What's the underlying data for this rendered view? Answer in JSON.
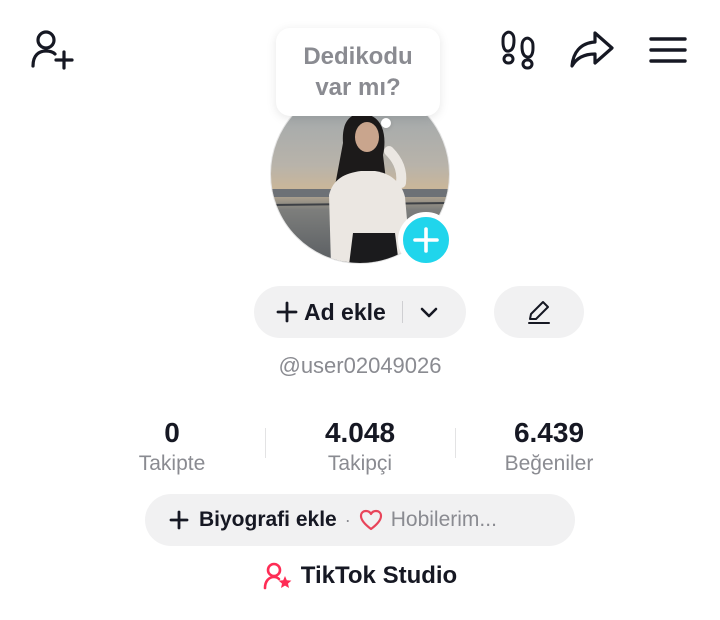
{
  "top_bar": {
    "add_user_icon": "person-add-icon",
    "footprint_icon": "footprints-icon",
    "share_icon": "share-arrow-icon",
    "menu_icon": "hamburger-menu-icon"
  },
  "note_bubble": {
    "line1": "Dedikodu",
    "line2": "var mı?"
  },
  "profile": {
    "avatar_add_icon": "plus-icon",
    "add_name_label": "Ad ekle",
    "username": "@user02049026"
  },
  "stats": [
    {
      "value": "0",
      "label": "Takipte"
    },
    {
      "value": "4.048",
      "label": "Takipçi"
    },
    {
      "value": "6.439",
      "label": "Beğeniler"
    }
  ],
  "bio": {
    "add_label": "Biyografi ekle",
    "separator": "·",
    "hobbies_label": "Hobilerim..."
  },
  "studio": {
    "label": "TikTok Studio"
  },
  "colors": {
    "accent_cyan": "#20d5ec",
    "heart_red": "#e8445a",
    "studio_pink": "#fe2c55",
    "muted_text": "#8a8b91",
    "pill_bg": "#f1f1f2"
  }
}
